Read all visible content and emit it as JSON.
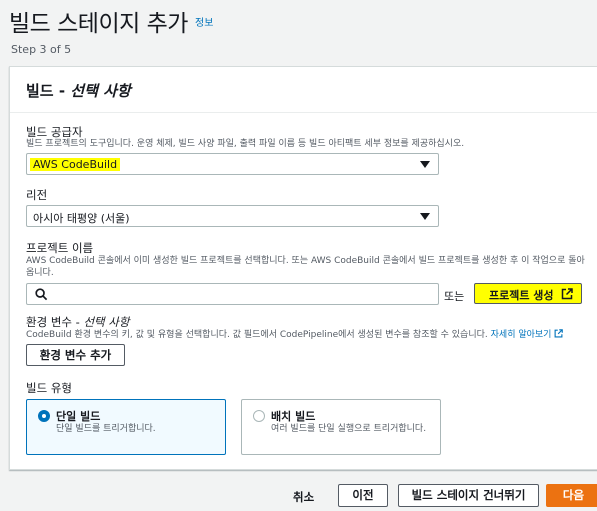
{
  "header": {
    "title": "빌드 스테이지 추가",
    "info_link": "정보",
    "step": "Step 3 of 5"
  },
  "panel": {
    "title_prefix": "빌드 - ",
    "title_italic": "선택 사항",
    "provider": {
      "label": "빌드 공급자",
      "description": "빌드 프로젝트의 도구입니다. 운영 체제, 빌드 사양 파일, 출력 파일 이름 등 빌드 아티팩트 세부 정보를 제공하십시오.",
      "value": "AWS CodeBuild"
    },
    "region": {
      "label": "리전",
      "value": "아시아 태평양 (서울)"
    },
    "project": {
      "label": "프로젝트 이름",
      "description": "AWS CodeBuild 콘솔에서 이미 생성한 빌드 프로젝트를 선택합니다. 또는 AWS CodeBuild 콘솔에서 빌드 프로젝트를 생성한 후 이 작업으로 돌아옵니다.",
      "search_placeholder": "",
      "or_text": "또는",
      "create_button": "프로젝트 생성"
    },
    "env": {
      "label_prefix": "환경 변수 - ",
      "label_italic": "선택 사항",
      "description": "CodeBuild 환경 변수의 키, 값 및 유형을 선택합니다. 값 필드에서 CodePipeline에서 생성된 변수를 참조할 수 있습니다.",
      "learn_more": "자세히 알아보기",
      "add_button": "환경 변수 추가"
    },
    "build_type": {
      "label": "빌드 유형",
      "options": [
        {
          "title": "단일 빌드",
          "description": "단일 빌드를 트리거합니다.",
          "selected": true
        },
        {
          "title": "배치 빌드",
          "description": "여러 빌드를 단일 실행으로 트리거합니다.",
          "selected": false
        }
      ]
    }
  },
  "footer": {
    "cancel": "취소",
    "previous": "이전",
    "skip": "빌드 스테이지 건너뛰기",
    "next": "다음"
  },
  "colors": {
    "primary": "#ec7211",
    "link": "#0073bb",
    "highlight": "#ffff00"
  }
}
